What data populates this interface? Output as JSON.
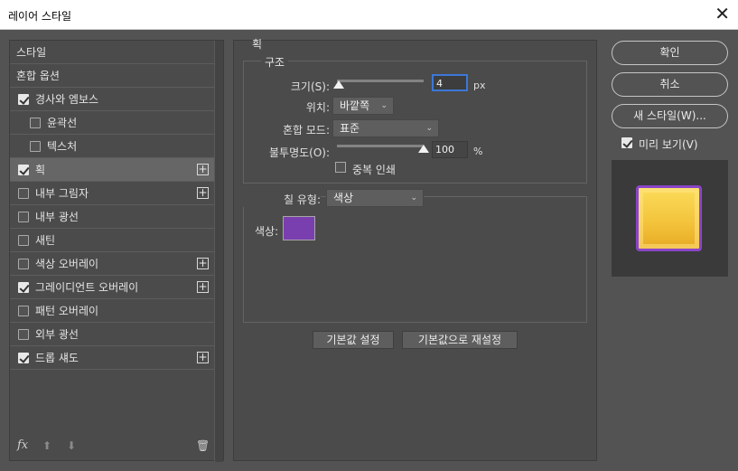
{
  "window": {
    "title": "레이어 스타일",
    "close_symbol": "✕"
  },
  "styles_list": [
    {
      "label": "스타일",
      "checkbox": false,
      "checked": false,
      "plus": false,
      "indent": false,
      "selected": false
    },
    {
      "label": "혼합 옵션",
      "checkbox": false,
      "checked": false,
      "plus": false,
      "indent": false,
      "selected": false
    },
    {
      "label": "경사와 엠보스",
      "checkbox": true,
      "checked": true,
      "plus": false,
      "indent": false,
      "selected": false
    },
    {
      "label": "윤곽선",
      "checkbox": true,
      "checked": false,
      "plus": false,
      "indent": true,
      "selected": false
    },
    {
      "label": "텍스처",
      "checkbox": true,
      "checked": false,
      "plus": false,
      "indent": true,
      "selected": false
    },
    {
      "label": "획",
      "checkbox": true,
      "checked": true,
      "plus": true,
      "indent": false,
      "selected": true
    },
    {
      "label": "내부 그림자",
      "checkbox": true,
      "checked": false,
      "plus": true,
      "indent": false,
      "selected": false
    },
    {
      "label": "내부 광선",
      "checkbox": true,
      "checked": false,
      "plus": false,
      "indent": false,
      "selected": false
    },
    {
      "label": "새틴",
      "checkbox": true,
      "checked": false,
      "plus": false,
      "indent": false,
      "selected": false
    },
    {
      "label": "색상 오버레이",
      "checkbox": true,
      "checked": false,
      "plus": true,
      "indent": false,
      "selected": false
    },
    {
      "label": "그레이디언트 오버레이",
      "checkbox": true,
      "checked": true,
      "plus": true,
      "indent": false,
      "selected": false
    },
    {
      "label": "패턴 오버레이",
      "checkbox": true,
      "checked": false,
      "plus": false,
      "indent": false,
      "selected": false
    },
    {
      "label": "외부 광선",
      "checkbox": true,
      "checked": false,
      "plus": false,
      "indent": false,
      "selected": false
    },
    {
      "label": "드롭 섀도",
      "checkbox": true,
      "checked": true,
      "plus": true,
      "indent": false,
      "selected": false
    }
  ],
  "footer_icons": {
    "fx": "fx",
    "up": "⬆",
    "down": "⬇",
    "trash": "🗑"
  },
  "stroke": {
    "section_title": "획",
    "structure_title": "구조",
    "size_label": "크기(S):",
    "size_value": "4",
    "size_unit": "px",
    "size_slider": 0.02,
    "position_label": "위치:",
    "position_value": "바깥쪽",
    "blend_label": "혼합 모드:",
    "blend_value": "표준",
    "opacity_label": "불투명도(O):",
    "opacity_value": "100",
    "opacity_unit": "%",
    "opacity_slider": 1.0,
    "overprint_label": "중복 인쇄",
    "overprint_checked": false,
    "fill_type_label": "칠 유형:",
    "fill_type_value": "색상",
    "color_label": "색상:",
    "color_hex": "#7a3fae",
    "default_btn": "기본값 설정",
    "reset_btn": "기본값으로 재설정"
  },
  "right": {
    "ok": "확인",
    "cancel": "취소",
    "new_style": "새 스타일(W)...",
    "preview_label": "미리 보기(V)",
    "preview_checked": true
  },
  "colors": {
    "accent_focus": "#3b78d8",
    "panel_bg": "#535353",
    "swatch_purple": "#7a3fae",
    "preview_yellow": "#f3c23a"
  }
}
